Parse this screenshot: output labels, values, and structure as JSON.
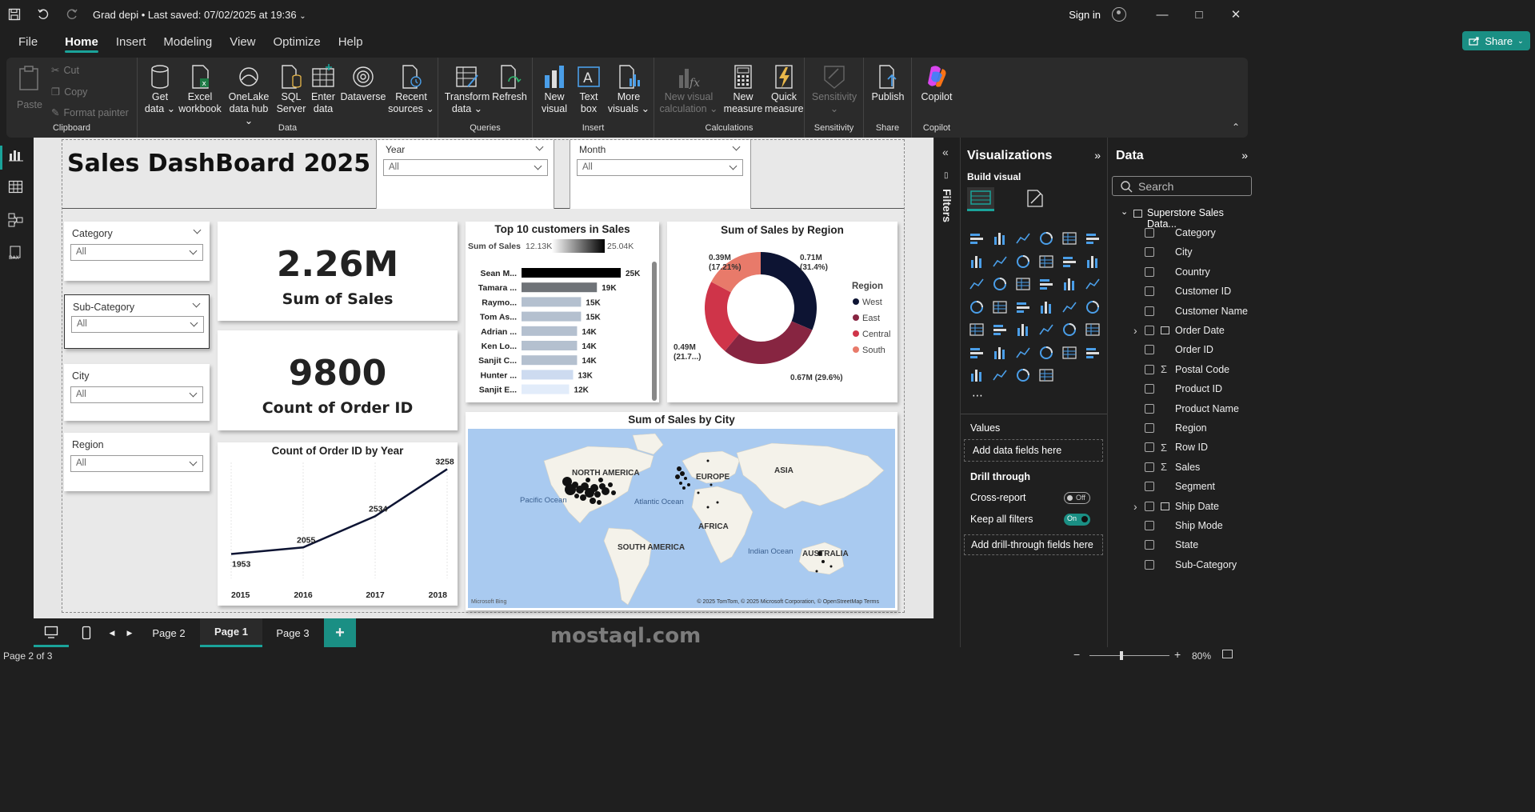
{
  "titlebar": {
    "doc_title": "Grad depi",
    "saved": "Last saved: 07/02/2025 at 19:36",
    "sign_in": "Sign in"
  },
  "menu": [
    "File",
    "Home",
    "Insert",
    "Modeling",
    "View",
    "Optimize",
    "Help"
  ],
  "share_label": "Share",
  "ribbon": {
    "clipboard": {
      "paste": "Paste",
      "cut": "Cut",
      "copy": "Copy",
      "format_painter": "Format painter",
      "label": "Clipboard"
    },
    "data": {
      "get_data": [
        "Get",
        "data"
      ],
      "excel": [
        "Excel",
        "workbook"
      ],
      "onelake": [
        "OneLake",
        "data hub"
      ],
      "sql": [
        "SQL",
        "Server"
      ],
      "enter": [
        "Enter",
        "data"
      ],
      "dataverse": [
        "Dataverse",
        ""
      ],
      "recent": [
        "Recent",
        "sources"
      ],
      "label": "Data"
    },
    "queries": {
      "transform": [
        "Transform",
        "data"
      ],
      "refresh": [
        "Refresh",
        ""
      ],
      "label": "Queries"
    },
    "insert": {
      "new_visual": [
        "New",
        "visual"
      ],
      "text_box": [
        "Text",
        "box"
      ],
      "more_visuals": [
        "More",
        "visuals"
      ],
      "label": "Insert"
    },
    "calculations": {
      "new_visual_calc": [
        "New visual",
        "calculation"
      ],
      "new_measure": [
        "New",
        "measure"
      ],
      "quick_measure": [
        "Quick",
        "measure"
      ],
      "label": "Calculations"
    },
    "sensitivity": {
      "btn": [
        "Sensitivity",
        ""
      ],
      "label": "Sensitivity"
    },
    "share": {
      "publish": [
        "Publish",
        ""
      ],
      "label": "Share"
    },
    "copilot": {
      "btn": [
        "Copilot",
        ""
      ],
      "label": "Copilot"
    }
  },
  "report": {
    "title": "Sales DashBoard 2025",
    "year_slicer": {
      "label": "Year",
      "value": "All"
    },
    "month_slicer": {
      "label": "Month",
      "value": "All"
    },
    "category_slicer": {
      "label": "Category",
      "value": "All"
    },
    "subcategory_slicer": {
      "label": "Sub-Category",
      "value": "All"
    },
    "city_slicer": {
      "label": "City",
      "value": "All"
    },
    "region_slicer": {
      "label": "Region",
      "value": "All"
    },
    "kpi_sales": {
      "value": "2.26M",
      "label": "Sum of Sales"
    },
    "kpi_orders": {
      "value": "9800",
      "label": "Count of Order ID"
    },
    "top10": {
      "title": "Top 10 customers in Sales",
      "legend_label": "Sum of Sales",
      "legend_min": "12.13K",
      "legend_max": "25.04K"
    },
    "region_chart": {
      "title": "Sum of Sales by Region",
      "legend_title": "Region"
    },
    "line_chart": {
      "title": "Count of Order ID by Year"
    },
    "map": {
      "title": "Sum of Sales by City",
      "labels": {
        "na": "NORTH AMERICA",
        "europe": "EUROPE",
        "asia": "ASIA",
        "africa": "AFRICA",
        "sa": "SOUTH AMERICA",
        "australia": "AUSTRALIA",
        "pacific": "Pacific Ocean",
        "atlantic": "Atlantic Ocean",
        "indian": "Indian Ocean"
      },
      "attribution": "© 2025 TomTom, © 2025 Microsoft Corporation, © OpenStreetMap  Terms",
      "bing": "Microsoft Bing"
    }
  },
  "chart_data": [
    {
      "type": "bar",
      "title": "Top 10 customers in Sales",
      "categories": [
        "Sean M...",
        "Tamara ...",
        "Raymo...",
        "Tom As...",
        "Adrian ...",
        "Ken Lo...",
        "Sanjit C...",
        "Hunter ...",
        "Sanjit E..."
      ],
      "values": [
        25,
        19,
        15,
        15,
        14,
        14,
        14,
        13,
        12
      ],
      "data_labels": [
        "25K",
        "19K",
        "15K",
        "15K",
        "14K",
        "14K",
        "14K",
        "13K",
        "12K"
      ],
      "xlim": [
        0,
        25
      ]
    },
    {
      "type": "pie",
      "title": "Sum of Sales by Region",
      "categories": [
        "West",
        "East",
        "Central",
        "South"
      ],
      "values": [
        0.71,
        0.67,
        0.49,
        0.39
      ],
      "data_labels": [
        "0.71M\n(31.4%)",
        "0.67M (29.6%)",
        "0.49M\n(21.7...)",
        "0.39M\n(17.21%)"
      ],
      "colors": [
        "#0d1433",
        "#872541",
        "#cf3449",
        "#e87a6a"
      ],
      "legend": "right"
    },
    {
      "type": "line",
      "title": "Count of Order ID by Year",
      "x": [
        "2015",
        "2016",
        "2017",
        "2018"
      ],
      "values": [
        1953,
        2055,
        2534,
        3258
      ],
      "ylim": [
        1800,
        3300
      ]
    }
  ],
  "filters_label": "Filters",
  "viz": {
    "title": "Visualizations",
    "build": "Build visual",
    "values_label": "Values",
    "add_fields": "Add data fields here",
    "drill": "Drill through",
    "cross": "Cross-report",
    "cross_state": "Off",
    "keep": "Keep all filters",
    "keep_state": "On",
    "add_drill": "Add drill-through fields here"
  },
  "data_pane": {
    "title": "Data",
    "search_placeholder": "Search",
    "table": "Superstore Sales Data...",
    "fields": [
      {
        "name": "Category",
        "kind": ""
      },
      {
        "name": "City",
        "kind": ""
      },
      {
        "name": "Country",
        "kind": ""
      },
      {
        "name": "Customer ID",
        "kind": ""
      },
      {
        "name": "Customer Name",
        "kind": ""
      },
      {
        "name": "Order Date",
        "kind": "table",
        "expand": true
      },
      {
        "name": "Order ID",
        "kind": ""
      },
      {
        "name": "Postal Code",
        "kind": "sigma"
      },
      {
        "name": "Product ID",
        "kind": ""
      },
      {
        "name": "Product Name",
        "kind": ""
      },
      {
        "name": "Region",
        "kind": ""
      },
      {
        "name": "Row ID",
        "kind": "sigma"
      },
      {
        "name": "Sales",
        "kind": "sigma"
      },
      {
        "name": "Segment",
        "kind": ""
      },
      {
        "name": "Ship Date",
        "kind": "table",
        "expand": true
      },
      {
        "name": "Ship Mode",
        "kind": ""
      },
      {
        "name": "State",
        "kind": ""
      },
      {
        "name": "Sub-Category",
        "kind": ""
      }
    ]
  },
  "pages": [
    "Page 2",
    "Page 1",
    "Page 3"
  ],
  "active_page": "Page 1",
  "status": {
    "page": "Page 2 of 3",
    "zoom": "80%"
  },
  "watermark": "mostaql.com",
  "colors": {
    "accent": "#1aa39a",
    "west": "#0d1433",
    "east": "#872541",
    "central": "#cf3449",
    "south": "#e87a6a"
  }
}
